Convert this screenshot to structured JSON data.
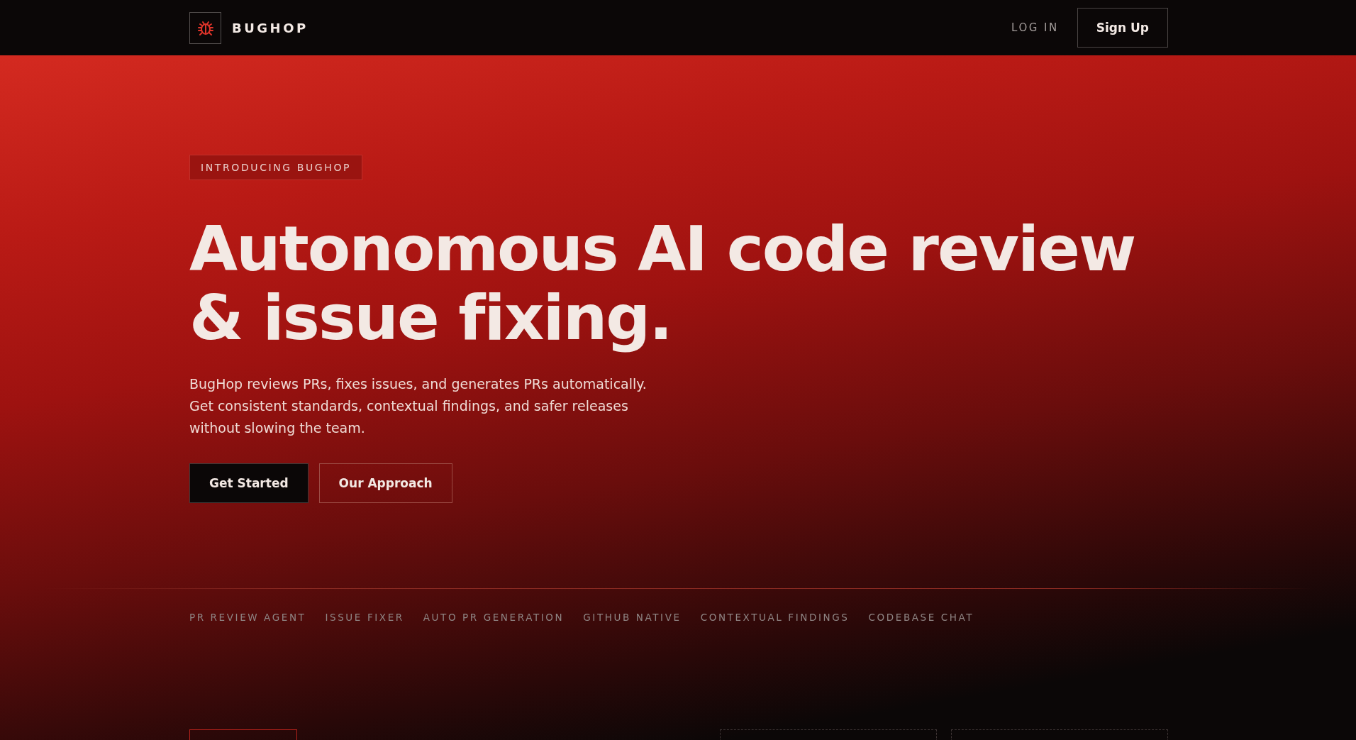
{
  "header": {
    "brand": "BUGHOP",
    "login": "LOG IN",
    "signup": "Sign Up"
  },
  "hero": {
    "badge": "INTRODUCING BUGHOP",
    "headline": [
      "Autonomous AI code review",
      "& issue fixing."
    ],
    "description": "BugHop reviews PRs, fixes issues, and generates PRs automatically. Get consistent standards, contextual findings, and safer releases without slowing the team.",
    "buttons": [
      {
        "label": "Get Started",
        "kind": "primary"
      },
      {
        "label": "Our Approach",
        "kind": "outline"
      }
    ]
  },
  "features": [
    "PR REVIEW AGENT",
    "ISSUE FIXER",
    "AUTO PR GENERATION",
    "GITHUB NATIVE",
    "CONTEXTUAL FINDINGS",
    "CODEBASE CHAT"
  ]
}
